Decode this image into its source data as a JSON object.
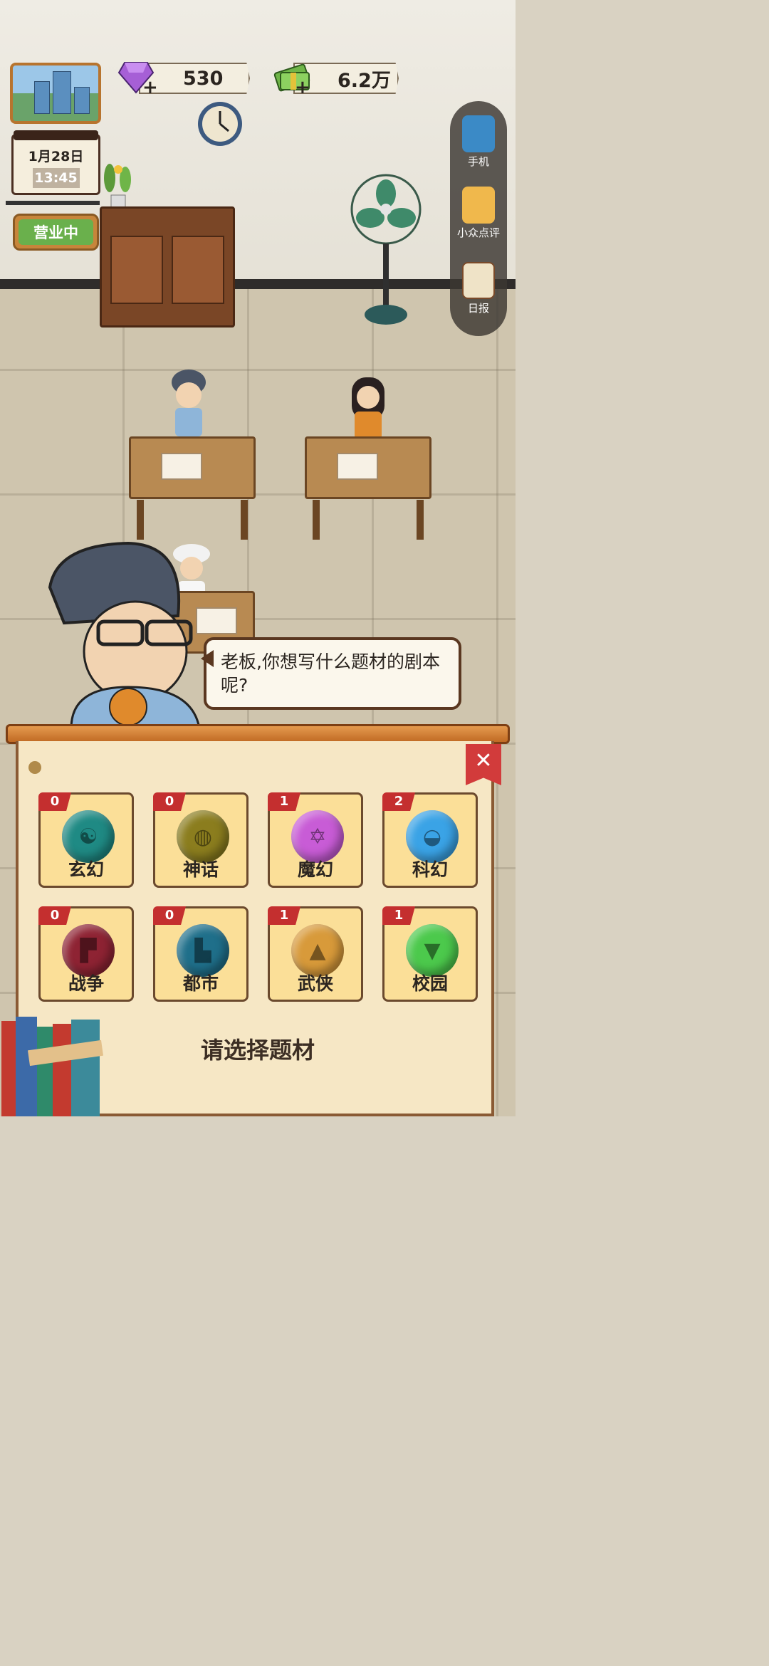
{
  "hud": {
    "gems": "530",
    "cash": "6.2万",
    "date": "1月28日",
    "time": "13:45",
    "open_sign": "营业中"
  },
  "side_menu": [
    {
      "label": "手机",
      "icon": "phone-icon"
    },
    {
      "label": "小众点评",
      "icon": "review-icon"
    },
    {
      "label": "日报",
      "icon": "report-icon"
    }
  ],
  "dialog": {
    "text": "老板,你想写什么题材的剧本呢?"
  },
  "genres": [
    {
      "name": "玄幻",
      "count": "0",
      "color": "#1f8a84",
      "icon": "meditation-icon"
    },
    {
      "name": "神话",
      "count": "0",
      "color": "#8b7d1e",
      "icon": "planet-icon"
    },
    {
      "name": "魔幻",
      "count": "1",
      "color": "#c85cd6",
      "icon": "hexagram-icon"
    },
    {
      "name": "科幻",
      "count": "2",
      "color": "#3aa3e6",
      "icon": "ufo-icon"
    },
    {
      "name": "战争",
      "count": "0",
      "color": "#8e2333",
      "icon": "pistol-icon"
    },
    {
      "name": "都市",
      "count": "0",
      "color": "#1f6f8a",
      "icon": "city-icon"
    },
    {
      "name": "武侠",
      "count": "1",
      "color": "#d89a3a",
      "icon": "bamboo-hat-icon"
    },
    {
      "name": "校园",
      "count": "1",
      "color": "#4cc94c",
      "icon": "uniform-icon"
    }
  ],
  "prompt": "请选择题材",
  "colors": {
    "accent_red": "#c42f2f",
    "panel_bg": "#f6e7c5",
    "card_bg": "#fbdf98",
    "open_green": "#6ab04c"
  }
}
